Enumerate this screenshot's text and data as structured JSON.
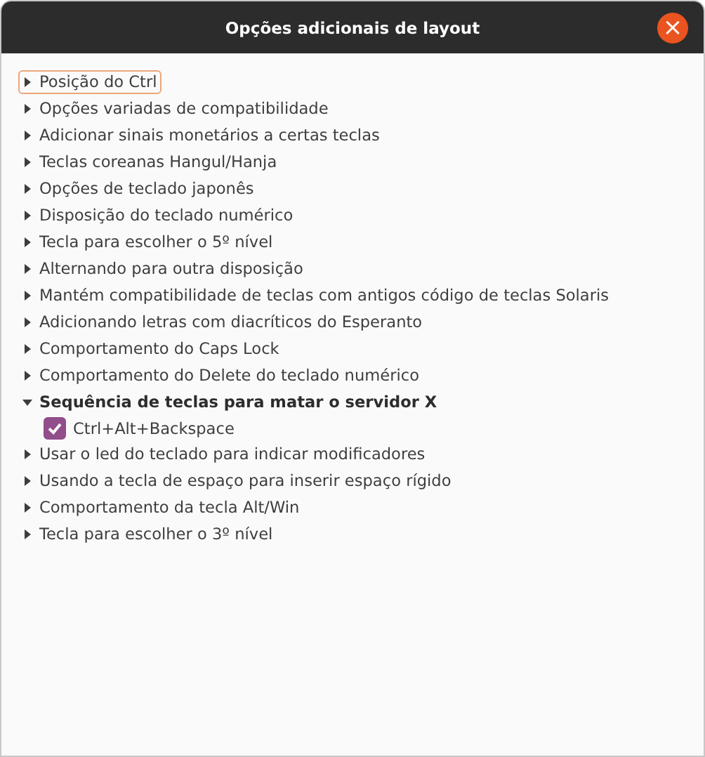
{
  "window": {
    "title": "Opções adicionais de layout",
    "close": "×"
  },
  "options": [
    {
      "label": "Posição do Ctrl",
      "expanded": false,
      "focused": true
    },
    {
      "label": "Opções variadas de compatibilidade",
      "expanded": false,
      "focused": false
    },
    {
      "label": "Adicionar sinais monetários a certas teclas",
      "expanded": false,
      "focused": false
    },
    {
      "label": "Teclas coreanas Hangul/Hanja",
      "expanded": false,
      "focused": false
    },
    {
      "label": "Opções de teclado japonês",
      "expanded": false,
      "focused": false
    },
    {
      "label": "Disposição do teclado numérico",
      "expanded": false,
      "focused": false
    },
    {
      "label": "Tecla para escolher o 5º nível",
      "expanded": false,
      "focused": false
    },
    {
      "label": "Alternando para outra disposição",
      "expanded": false,
      "focused": false
    },
    {
      "label": "Mantém compatibilidade de teclas com antigos código de teclas Solaris",
      "expanded": false,
      "focused": false
    },
    {
      "label": "Adicionando letras com diacríticos do Esperanto",
      "expanded": false,
      "focused": false
    },
    {
      "label": "Comportamento do Caps Lock",
      "expanded": false,
      "focused": false
    },
    {
      "label": "Comportamento do Delete do teclado numérico",
      "expanded": false,
      "focused": false
    },
    {
      "label": "Sequência de teclas para matar o servidor X",
      "expanded": true,
      "focused": false,
      "children": [
        {
          "label": "Ctrl+Alt+Backspace",
          "checked": true
        }
      ]
    },
    {
      "label": "Usar o led do teclado para indicar modificadores",
      "expanded": false,
      "focused": false
    },
    {
      "label": "Usando a tecla de espaço para inserir espaço rígido",
      "expanded": false,
      "focused": false
    },
    {
      "label": "Comportamento da tecla Alt/Win",
      "expanded": false,
      "focused": false
    },
    {
      "label": "Tecla para escolher o 3º nível",
      "expanded": false,
      "focused": false
    }
  ]
}
